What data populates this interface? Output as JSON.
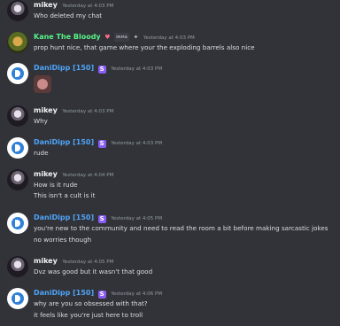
{
  "messages": [
    {
      "author": "mikey",
      "time": "Yesterday at 4:03 PM",
      "lines": [
        "Who deleted my chat"
      ],
      "continuation": true
    },
    {
      "author": "Kane The Bloody",
      "time": "Yesterday at 4:03 PM",
      "badge": "ɪɴᴍᴀ",
      "lines": [
        "prop hunt nice, that game where your the exploding barrels also nice"
      ]
    },
    {
      "author": "DaniDipp [150]",
      "time": "Yesterday at 4:03 PM",
      "sticker": "mouse-sticker"
    },
    {
      "author": "mikey",
      "time": "Yesterday at 4:03 PM",
      "lines": [
        "Why"
      ]
    },
    {
      "author": "DaniDipp [150]",
      "time": "Yesterday at 4:03 PM",
      "lines": [
        "rude"
      ]
    },
    {
      "author": "mikey",
      "time": "Yesterday at 4:04 PM",
      "lines": [
        "How is it rude",
        "This isn't a cult is it"
      ]
    },
    {
      "author": "DaniDipp [150]",
      "time": "Yesterday at 4:05 PM",
      "lines": [
        "you're new to the community and need to read the room a bit before making sarcastic jokes",
        "no worries though"
      ]
    },
    {
      "author": "mikey",
      "time": "Yesterday at 4:05 PM",
      "lines": [
        "Dvz was good but it wasn't that good"
      ]
    },
    {
      "author": "DaniDipp [150]",
      "time": "Yesterday at 4:06 PM",
      "lines": [
        "why are you so obsessed with that?",
        "it feels like you're just here to troll"
      ]
    }
  ],
  "colors": {
    "background": "#313338",
    "kane": "#57f287",
    "dani": "#4fa3f7",
    "mikey": "#f2f3f5"
  }
}
